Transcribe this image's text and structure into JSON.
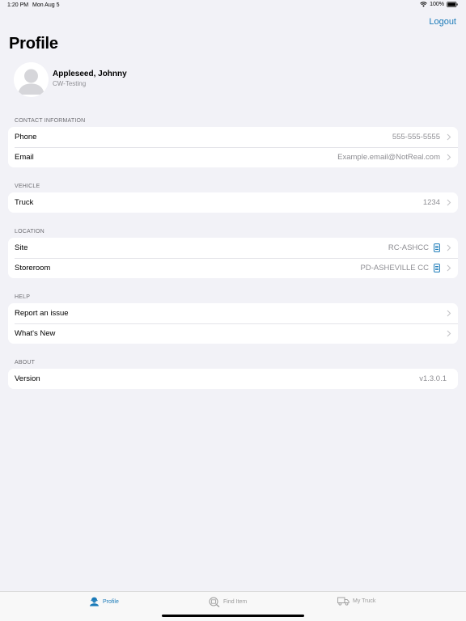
{
  "status": {
    "time": "1:20 PM",
    "date": "Mon Aug 5",
    "battery": "100%"
  },
  "header": {
    "logout_label": "Logout",
    "title": "Profile"
  },
  "user": {
    "name": "Appleseed, Johnny",
    "subtitle": "CW-Testing"
  },
  "sections": {
    "contact": {
      "header": "CONTACT INFORMATION",
      "phone_label": "Phone",
      "phone_value": "555-555-5555",
      "email_label": "Email",
      "email_value": "Example.email@NotReal.com"
    },
    "vehicle": {
      "header": "VEHICLE",
      "truck_label": "Truck",
      "truck_value": "1234"
    },
    "location": {
      "header": "LOCATION",
      "site_label": "Site",
      "site_value": "RC-ASHCC",
      "storeroom_label": "Storeroom",
      "storeroom_value": "PD-ASHEVILLE CC"
    },
    "help": {
      "header": "HELP",
      "report_label": "Report an issue",
      "whatsnew_label": "What's New"
    },
    "about": {
      "header": "ABOUT",
      "version_label": "Version",
      "version_value": "v1.3.0.1"
    }
  },
  "tabs": [
    {
      "label": "Profile",
      "icon": "profile-icon",
      "active": true
    },
    {
      "label": "Find Item",
      "icon": "find-item-icon",
      "active": false
    },
    {
      "label": "My Truck",
      "icon": "truck-icon",
      "active": false
    }
  ],
  "colors": {
    "accent": "#1a7ab8",
    "background": "#f2f2f7",
    "secondary_text": "#8e8e93"
  }
}
